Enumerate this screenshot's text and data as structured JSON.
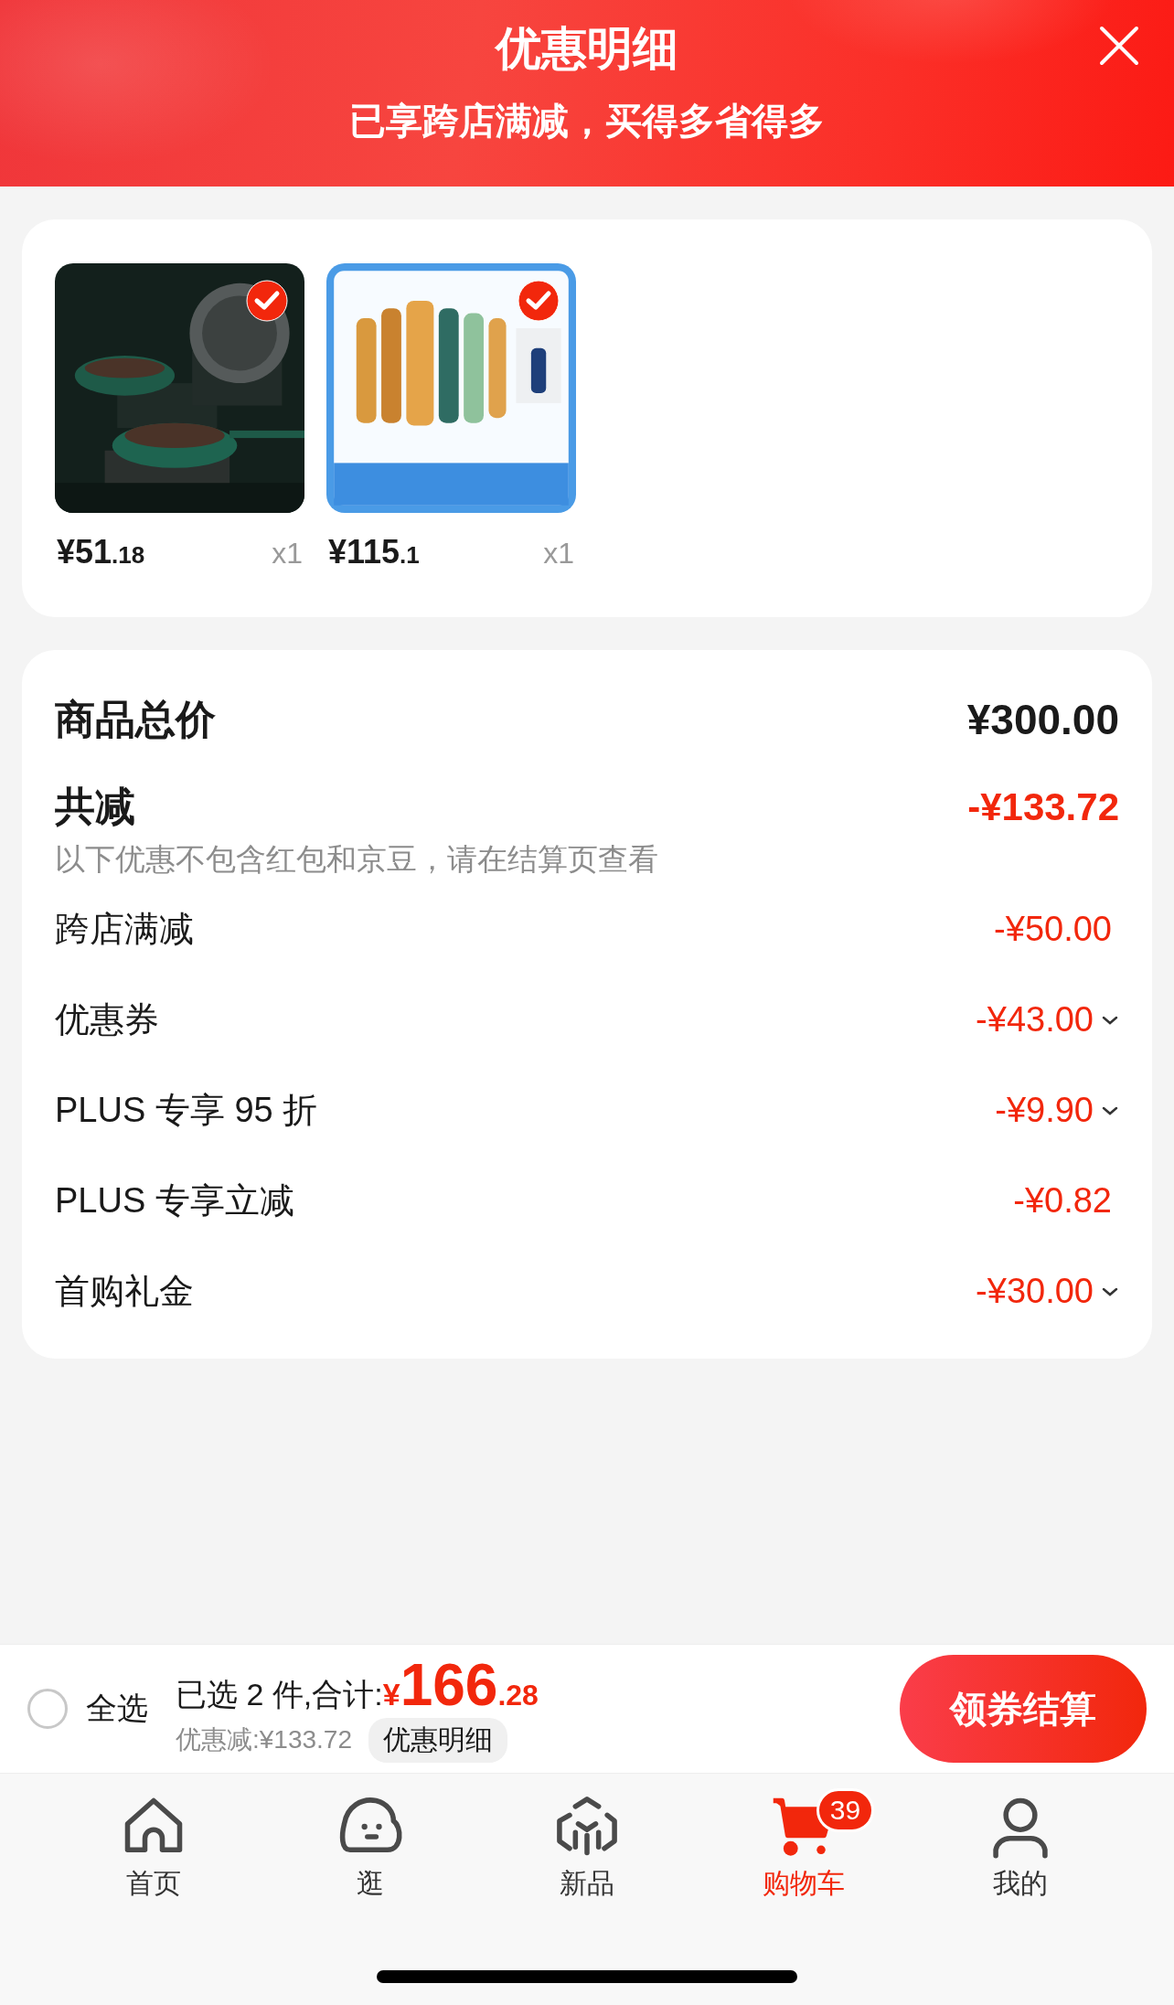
{
  "header": {
    "title": "优惠明细",
    "subtitle": "已享跨店满减，买得多省得多"
  },
  "products": [
    {
      "kind": "pans",
      "price": "¥51",
      "price_fraction": ".18",
      "quantity": "x1",
      "checked": true
    },
    {
      "kind": "bottles",
      "price": "¥115",
      "price_fraction": ".1",
      "quantity": "x1",
      "checked": true
    }
  ],
  "summary": {
    "total_label": "商品总价",
    "total_value": "¥300.00",
    "reduction_label": "共减",
    "reduction_value": "-¥133.72",
    "note": "以下优惠不包含红包和京豆，请在结算页查看",
    "discounts": [
      {
        "label": "跨店满减",
        "value": "-¥50.00",
        "expandable": false
      },
      {
        "label": "优惠券",
        "value": "-¥43.00",
        "expandable": true
      },
      {
        "label": "PLUS 专享 95 折",
        "value": "-¥9.90",
        "expandable": true
      },
      {
        "label": "PLUS 专享立减",
        "value": "-¥0.82",
        "expandable": false
      },
      {
        "label": "首购礼金",
        "value": "-¥30.00",
        "expandable": true
      }
    ]
  },
  "footer": {
    "select_all": {
      "label": "全选",
      "checked": false
    },
    "selected_text": "已选 2 件,合计:",
    "currency": "¥",
    "total": "166",
    "total_fraction": ".28",
    "discount_text": "优惠减:¥133.72",
    "details_button": "优惠明细",
    "checkout_button": "领券结算"
  },
  "tabs": [
    {
      "kind": "home",
      "label": "首页",
      "selected": false
    },
    {
      "kind": "face",
      "label": "逛",
      "selected": false
    },
    {
      "kind": "cube",
      "label": "新品",
      "selected": false
    },
    {
      "kind": "cart",
      "label": "购物车",
      "selected": true,
      "badge": "39"
    },
    {
      "kind": "person",
      "label": "我的",
      "selected": false
    }
  ]
}
